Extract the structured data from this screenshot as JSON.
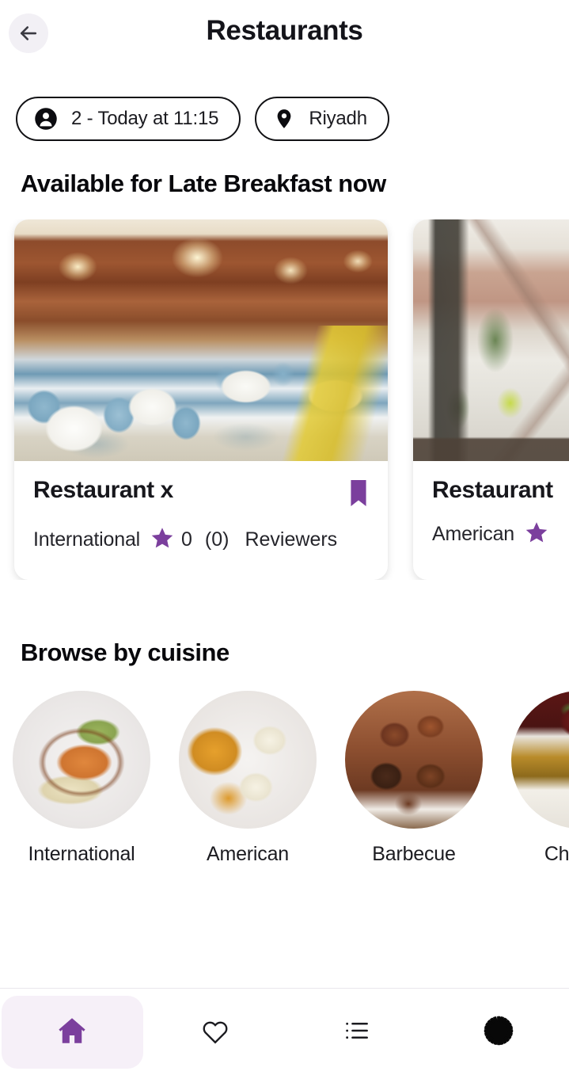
{
  "header": {
    "title": "Restaurants",
    "back_icon": "arrow-left-icon"
  },
  "filters": [
    {
      "icon": "person-icon",
      "label": "2 - Today at 11:15",
      "name": "party-and-time-filter"
    },
    {
      "icon": "location-pin-icon",
      "label": "Riyadh",
      "name": "location-filter"
    }
  ],
  "available_section": {
    "title": "Available for Late Breakfast now",
    "cards": [
      {
        "name": "Restaurant x",
        "cuisine": "International",
        "rating": "0",
        "review_count": "(0)",
        "reviewers_label": "Reviewers",
        "bookmark_icon": "bookmark-icon",
        "star_icon": "star-icon",
        "photo": "classic-dining-room"
      },
      {
        "name": "Restaurant",
        "cuisine": "American",
        "rating": "",
        "review_count": "",
        "reviewers_label": "",
        "bookmark_icon": "bookmark-icon",
        "star_icon": "star-icon",
        "photo": "outdoor-terrace"
      }
    ]
  },
  "cuisine_section": {
    "title": "Browse by cuisine",
    "items": [
      {
        "label": "International",
        "photo": "fried-chicken-pasta"
      },
      {
        "label": "American",
        "photo": "eggs-benedict"
      },
      {
        "label": "Barbecue",
        "photo": "grilled-brisket"
      },
      {
        "label": "Chinese",
        "photo": "chinese-dish"
      }
    ]
  },
  "bottom_nav": {
    "items": [
      {
        "icon": "home-icon",
        "name": "nav-home",
        "active": true
      },
      {
        "icon": "heart-icon",
        "name": "nav-favorites",
        "active": false
      },
      {
        "icon": "list-icon",
        "name": "nav-bookings",
        "active": false
      },
      {
        "icon": "gear-icon",
        "name": "nav-settings",
        "active": false
      }
    ]
  },
  "colors": {
    "accent_purple": "#7B3F9D",
    "active_nav_bg": "#F6F0F8",
    "back_button_bg": "#F2F0F5",
    "text_dark": "#14141A"
  }
}
